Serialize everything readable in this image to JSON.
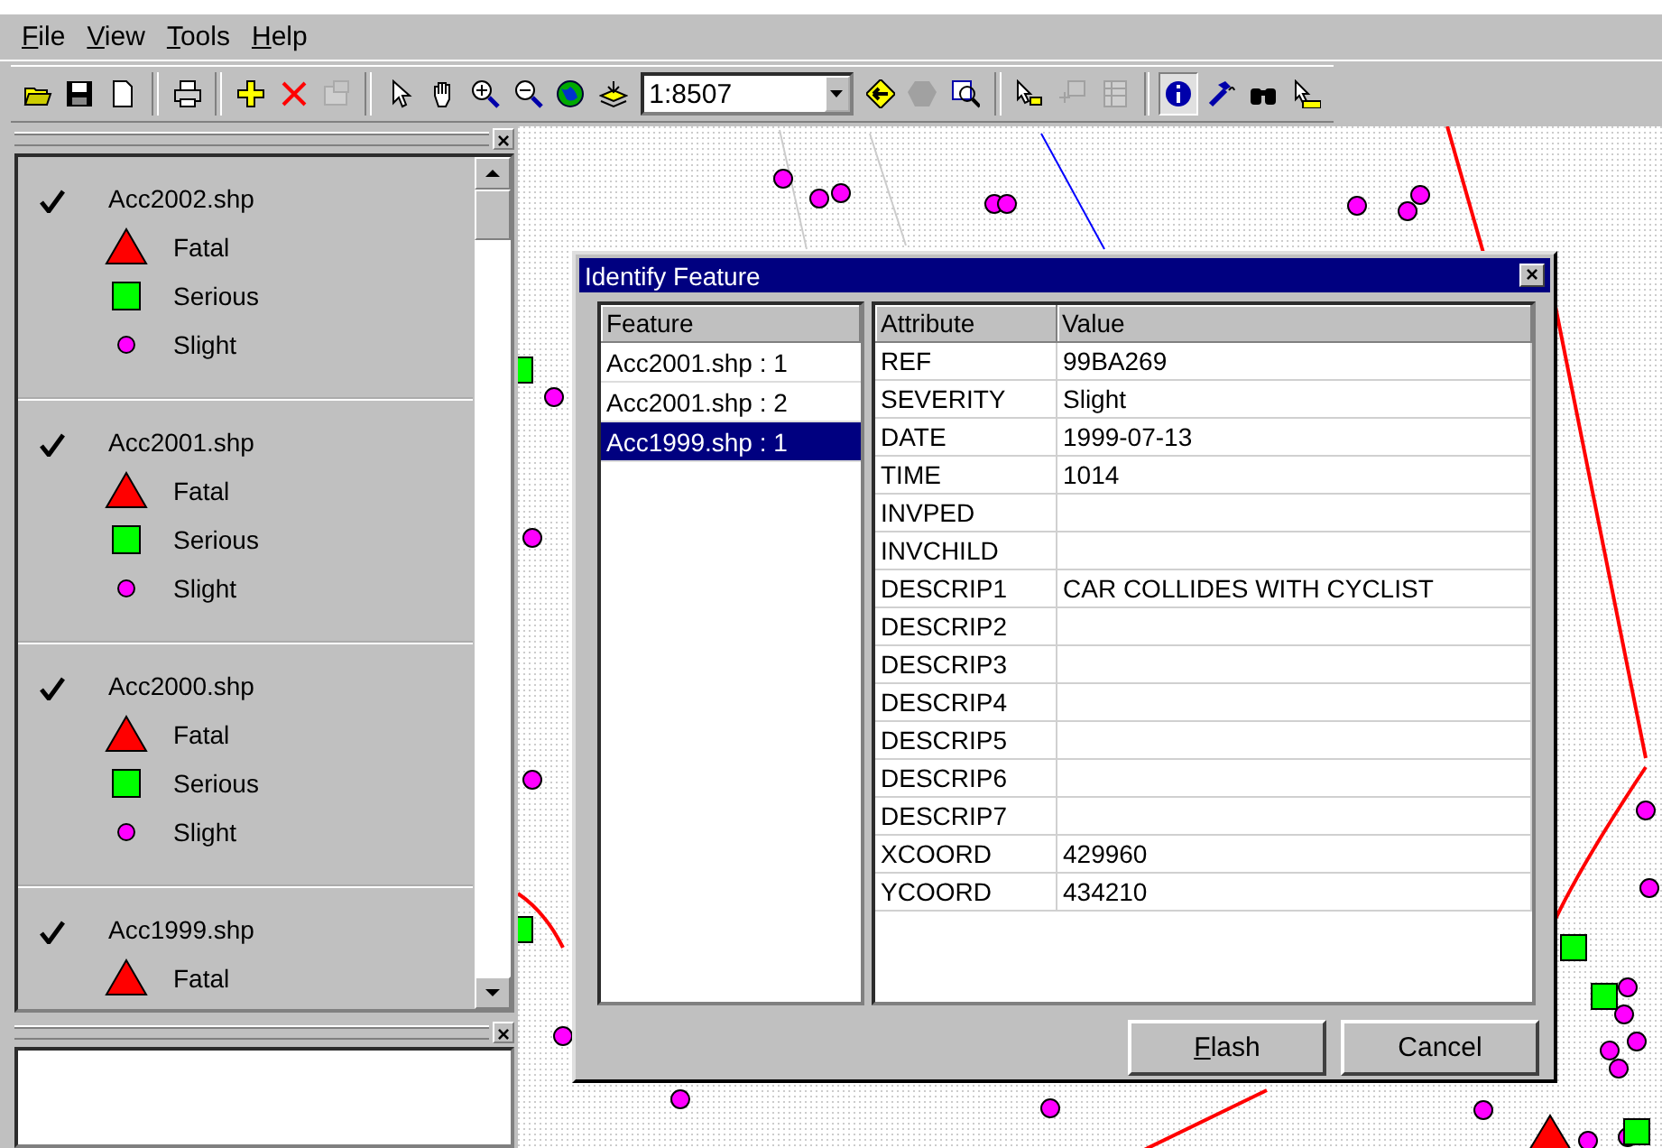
{
  "menu": [
    {
      "label": "File"
    },
    {
      "label": "View"
    },
    {
      "label": "Tools"
    },
    {
      "label": "Help"
    }
  ],
  "toolbar": [
    {
      "kind": "open",
      "disabled": false,
      "pressed": false
    },
    {
      "kind": "save",
      "disabled": false,
      "pressed": false
    },
    {
      "kind": "new",
      "disabled": false,
      "pressed": false
    },
    {
      "kind": "separator"
    },
    {
      "kind": "print",
      "disabled": false,
      "pressed": false
    },
    {
      "kind": "separator"
    },
    {
      "kind": "add-layer",
      "disabled": false,
      "pressed": false
    },
    {
      "kind": "remove-layer",
      "disabled": false,
      "pressed": false
    },
    {
      "kind": "properties",
      "disabled": true,
      "pressed": false
    },
    {
      "kind": "separator"
    },
    {
      "kind": "pointer",
      "disabled": false,
      "pressed": false
    },
    {
      "kind": "pan",
      "disabled": false,
      "pressed": false
    },
    {
      "kind": "zoom-in",
      "disabled": false,
      "pressed": false
    },
    {
      "kind": "zoom-out",
      "disabled": false,
      "pressed": false
    },
    {
      "kind": "globe",
      "disabled": false,
      "pressed": false
    },
    {
      "kind": "zoom-layer",
      "disabled": false,
      "pressed": false
    },
    {
      "kind": "scale",
      "value": "1:8507"
    },
    {
      "kind": "back",
      "disabled": false,
      "pressed": false
    },
    {
      "kind": "shape",
      "disabled": true,
      "pressed": false
    },
    {
      "kind": "zoom-select",
      "disabled": false,
      "pressed": false
    },
    {
      "kind": "separator"
    },
    {
      "kind": "select-features",
      "disabled": false,
      "pressed": false
    },
    {
      "kind": "clear-select",
      "disabled": true,
      "pressed": false
    },
    {
      "kind": "table",
      "disabled": true,
      "pressed": false
    },
    {
      "kind": "separator"
    },
    {
      "kind": "info",
      "disabled": false,
      "pressed": true
    },
    {
      "kind": "hammer",
      "disabled": false,
      "pressed": false
    },
    {
      "kind": "find",
      "disabled": false,
      "pressed": false
    },
    {
      "kind": "measure",
      "disabled": false,
      "pressed": false
    }
  ],
  "panels": [
    {
      "close": "×"
    },
    {
      "close": "×"
    }
  ],
  "legend": [
    {
      "name": "Acc2002.shp",
      "checked": true,
      "classes": [
        {
          "kind": "triangle",
          "label": "Fatal"
        },
        {
          "kind": "square",
          "label": "Serious"
        },
        {
          "kind": "circle",
          "label": "Slight"
        }
      ]
    },
    {
      "name": "Acc2001.shp",
      "checked": true,
      "classes": [
        {
          "kind": "triangle",
          "label": "Fatal"
        },
        {
          "kind": "square",
          "label": "Serious"
        },
        {
          "kind": "circle",
          "label": "Slight"
        }
      ]
    },
    {
      "name": "Acc2000.shp",
      "checked": true,
      "classes": [
        {
          "kind": "triangle",
          "label": "Fatal"
        },
        {
          "kind": "square",
          "label": "Serious"
        },
        {
          "kind": "circle",
          "label": "Slight"
        }
      ]
    },
    {
      "name": "Acc1999.shp",
      "checked": true,
      "classes": [
        {
          "kind": "triangle",
          "label": "Fatal"
        }
      ]
    }
  ],
  "dialog": {
    "title": "Identify Feature",
    "close": "×",
    "feature_list": {
      "heading": "Feature",
      "items": [
        {
          "label": "Acc2001.shp : 1",
          "selected": false
        },
        {
          "label": "Acc2001.shp : 2",
          "selected": false
        },
        {
          "label": "Acc1999.shp : 1",
          "selected": true
        }
      ]
    },
    "attributes": {
      "columns": [
        "Attribute",
        "Value"
      ],
      "rows": [
        [
          "REF",
          "99BA269"
        ],
        [
          "SEVERITY",
          "Slight"
        ],
        [
          "DATE",
          "1999-07-13"
        ],
        [
          "TIME",
          "1014"
        ],
        [
          "INVPED",
          ""
        ],
        [
          "INVCHILD",
          ""
        ],
        [
          "DESCRIP1",
          "CAR COLLIDES WITH CYCLIST"
        ],
        [
          "DESCRIP2",
          ""
        ],
        [
          "DESCRIP3",
          ""
        ],
        [
          "DESCRIP4",
          ""
        ],
        [
          "DESCRIP5",
          ""
        ],
        [
          "DESCRIP6",
          ""
        ],
        [
          "DESCRIP7",
          ""
        ],
        [
          "XCOORD",
          "429960"
        ],
        [
          "YCOORD",
          "434210"
        ]
      ]
    },
    "buttons": [
      {
        "label": "Flash",
        "mnemonic": true
      },
      {
        "label": "Cancel",
        "mnemonic": false
      }
    ]
  }
}
